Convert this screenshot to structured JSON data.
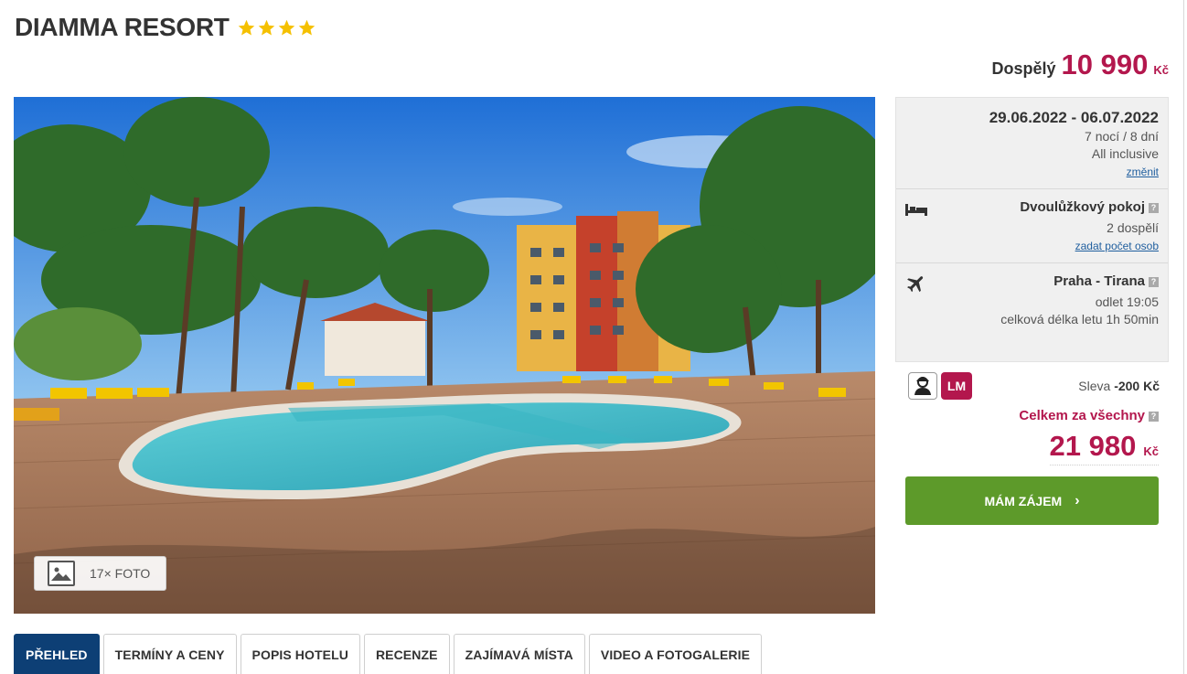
{
  "hotel": {
    "name": "DIAMMA RESORT",
    "stars": 4
  },
  "price_per_adult": {
    "label": "Dospělý",
    "value": "10 990",
    "currency": "Kč"
  },
  "photo": {
    "count_label": "17× FOTO"
  },
  "booking": {
    "dates": "29.06.2022 - 06.07.2022",
    "duration": "7 nocí / 8 dní",
    "board": "All inclusive",
    "change_link": "změnit",
    "room_type": "Dvoulůžkový pokoj",
    "persons": "2 dospělí",
    "persons_link": "zadat počet osob",
    "flight_route": "Praha - Tirana",
    "departure": "odlet 19:05",
    "flight_duration": "celková délka letu 1h 50min",
    "help_mark": "?"
  },
  "discount": {
    "badge": "LM",
    "label": "Sleva",
    "amount": "-200 Kč"
  },
  "total": {
    "label": "Celkem za všechny",
    "value": "21 980",
    "currency": "Kč"
  },
  "cta": {
    "label": "MÁM ZÁJEM",
    "chevron": "›"
  },
  "tabs": [
    {
      "label": "PŘEHLED",
      "active": true
    },
    {
      "label": "TERMÍNY A CENY"
    },
    {
      "label": "POPIS HOTELU"
    },
    {
      "label": "RECENZE"
    },
    {
      "label": "ZAJÍMAVÁ MÍSTA"
    },
    {
      "label": "VIDEO A FOTOGALERIE"
    }
  ],
  "colors": {
    "brand_price": "#b3174d",
    "cta_green": "#5d9a2a",
    "active_tab": "#0d3f75",
    "star": "#f5c000"
  },
  "icons": [
    "star-icon",
    "image-gallery-icon",
    "bed-icon",
    "airplane-icon",
    "help-icon",
    "agent-icon",
    "chevron-right-icon"
  ]
}
